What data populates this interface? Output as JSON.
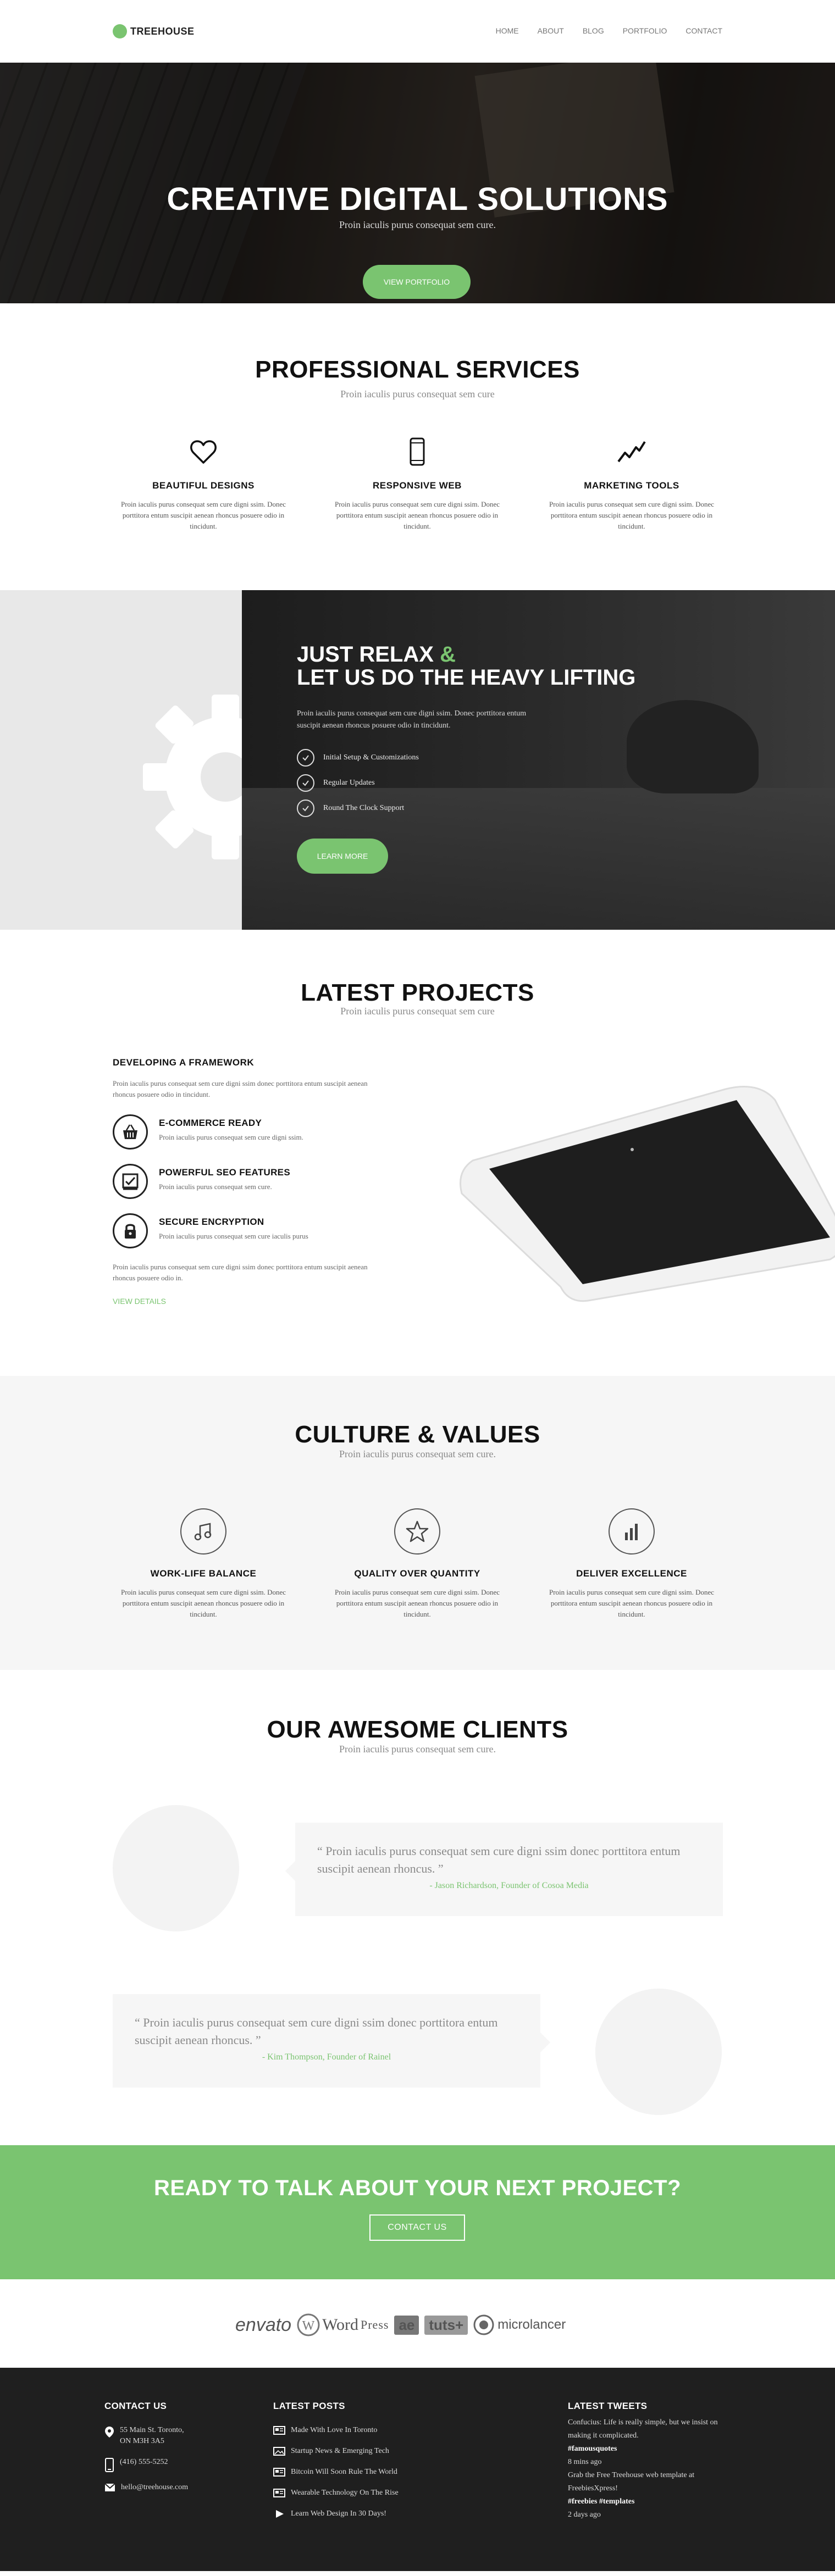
{
  "brand": {
    "logo_text": "TREEHOUSE",
    "accent": "#7ac470"
  },
  "nav": {
    "items": [
      "HOME",
      "ABOUT",
      "BLOG",
      "PORTFOLIO",
      "CONTACT"
    ]
  },
  "hero": {
    "title": "CREATIVE DIGITAL SOLUTIONS",
    "subtitle": "Proin iaculis purus consequat sem cure.",
    "button": "VIEW PORTFOLIO"
  },
  "services": {
    "title": "PROFESSIONAL SERVICES",
    "subtitle": "Proin iaculis purus consequat sem cure",
    "items": [
      {
        "icon": "heart-icon",
        "title": "BEAUTIFUL DESIGNS",
        "text": "Proin iaculis purus consequat sem cure digni ssim. Donec porttitora entum suscipit aenean rhoncus posuere odio in tincidunt."
      },
      {
        "icon": "phone-icon",
        "title": "RESPONSIVE WEB",
        "text": "Proin iaculis purus consequat sem cure digni ssim. Donec porttitora entum suscipit aenean rhoncus posuere odio in tincidunt."
      },
      {
        "icon": "trend-icon",
        "title": "MARKETING TOOLS",
        "text": "Proin iaculis purus consequat sem cure digni ssim. Donec porttitora entum suscipit aenean rhoncus posuere odio in tincidunt."
      }
    ]
  },
  "relax": {
    "title_line1": "JUST RELAX",
    "title_amp": "&",
    "title_line2": "LET US DO THE HEAVY LIFTING",
    "text": "Proin iaculis purus consequat sem cure digni ssim. Donec porttitora entum suscipit aenean rhoncus posuere odio in tincidunt.",
    "checks": [
      "Initial Setup & Customizations",
      "Regular Updates",
      "Round The Clock Support"
    ],
    "button": "LEARN MORE"
  },
  "projects": {
    "title": "LATEST PROJECTS",
    "subtitle": "Proin iaculis purus consequat sem cure",
    "heading": "DEVELOPING A FRAMEWORK",
    "intro": "Proin iaculis purus consequat sem cure digni ssim donec porttitora entum suscipit aenean rhoncus posuere odio in tincidunt.",
    "features": [
      {
        "icon": "basket-icon",
        "title": "E-COMMERCE READY",
        "text": "Proin iaculis purus consequat sem cure digni ssim."
      },
      {
        "icon": "chart-check-icon",
        "title": "POWERFUL SEO FEATURES",
        "text": "Proin iaculis purus consequat sem cure."
      },
      {
        "icon": "lock-icon",
        "title": "SECURE ENCRYPTION",
        "text": "Proin iaculis purus consequat sem cure iaculis purus"
      }
    ],
    "outro": "Proin iaculis purus consequat sem cure digni ssim donec porttitora entum suscipit aenean rhoncus posuere odio in.",
    "link": "VIEW DETAILS"
  },
  "culture": {
    "title": "CULTURE & VALUES",
    "subtitle": "Proin iaculis purus consequat sem cure.",
    "items": [
      {
        "icon": "music-icon",
        "title": "WORK-LIFE BALANCE",
        "text": "Proin iaculis purus consequat sem cure digni ssim. Donec porttitora entum suscipit aenean rhoncus posuere odio in tincidunt."
      },
      {
        "icon": "star-icon",
        "title": "QUALITY OVER QUANTITY",
        "text": "Proin iaculis purus consequat sem cure digni ssim. Donec porttitora entum suscipit aenean rhoncus posuere odio in tincidunt."
      },
      {
        "icon": "bar-chart-icon",
        "title": "DELIVER EXCELLENCE",
        "text": "Proin iaculis purus consequat sem cure digni ssim. Donec porttitora entum suscipit aenean rhoncus posuere odio in tincidunt."
      }
    ]
  },
  "clients": {
    "title": "OUR AWESOME CLIENTS",
    "subtitle": "Proin iaculis purus consequat sem cure.",
    "testimonials": [
      {
        "quote": "“ Proin iaculis purus consequat sem cure digni ssim donec porttitora entum suscipit aenean rhoncus. ”",
        "author": "- Jason Richardson, Founder of Cosoa Media"
      },
      {
        "quote": "“ Proin iaculis purus consequat sem cure digni ssim donec porttitora entum suscipit aenean rhoncus. ”",
        "author": "- Kim Thompson, Founder of Rainel"
      }
    ]
  },
  "cta": {
    "title": "READY TO TALK ABOUT YOUR NEXT PROJECT?",
    "button": "CONTACT US"
  },
  "partners": {
    "envato": "envato",
    "wordpress_a": "Word",
    "wordpress_b": "Press",
    "ae": "ae",
    "tuts": "tuts+",
    "microlancer": "microlancer"
  },
  "footer": {
    "contact_title": "CONTACT US",
    "address_line1": "55 Main St. Toronto,",
    "address_line2": "ON M3H 3A5",
    "phone": "(416) 555-5252",
    "email": "hello@treehouse.com",
    "posts_title": "LATEST POSTS",
    "posts": [
      "Made With Love In Toronto",
      "Startup News & Emerging Tech",
      "Bitcoin Will Soon Rule The World",
      "Wearable Technology On The Rise",
      "Learn Web Design In 30 Days!"
    ],
    "tweets_title": "LATEST TWEETS",
    "tweet1_text": "Confucius: Life is really simple, but we insist on making it complicated.",
    "tweet1_tag": "#famousquotes",
    "tweet1_time": "8 mins ago",
    "tweet2_text": "Grab the Free Treehouse web template at FreebiesXpress!",
    "tweet2_tag": "#freebies #templates",
    "tweet2_time": "2 days ago"
  }
}
